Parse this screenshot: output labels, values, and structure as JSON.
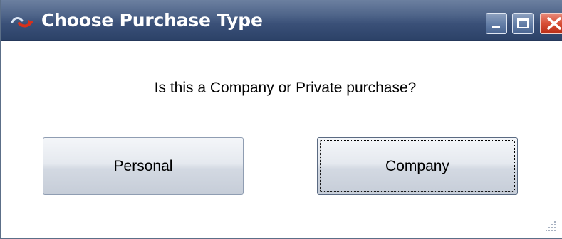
{
  "window": {
    "title": "Choose Purchase Type",
    "icon": "app-logo-icon",
    "controls": {
      "minimize": "minimize-icon",
      "maximize": "maximize-icon",
      "close": "close-icon"
    }
  },
  "dialog": {
    "prompt": "Is this a Company or Private purchase?",
    "buttons": {
      "personal": "Personal",
      "company": "Company"
    },
    "focused_button": "company"
  },
  "colors": {
    "titlebar": "#3a5078",
    "title_text": "#ffffff",
    "close_button": "#d84f36",
    "button_face": "#e0e5ec"
  }
}
